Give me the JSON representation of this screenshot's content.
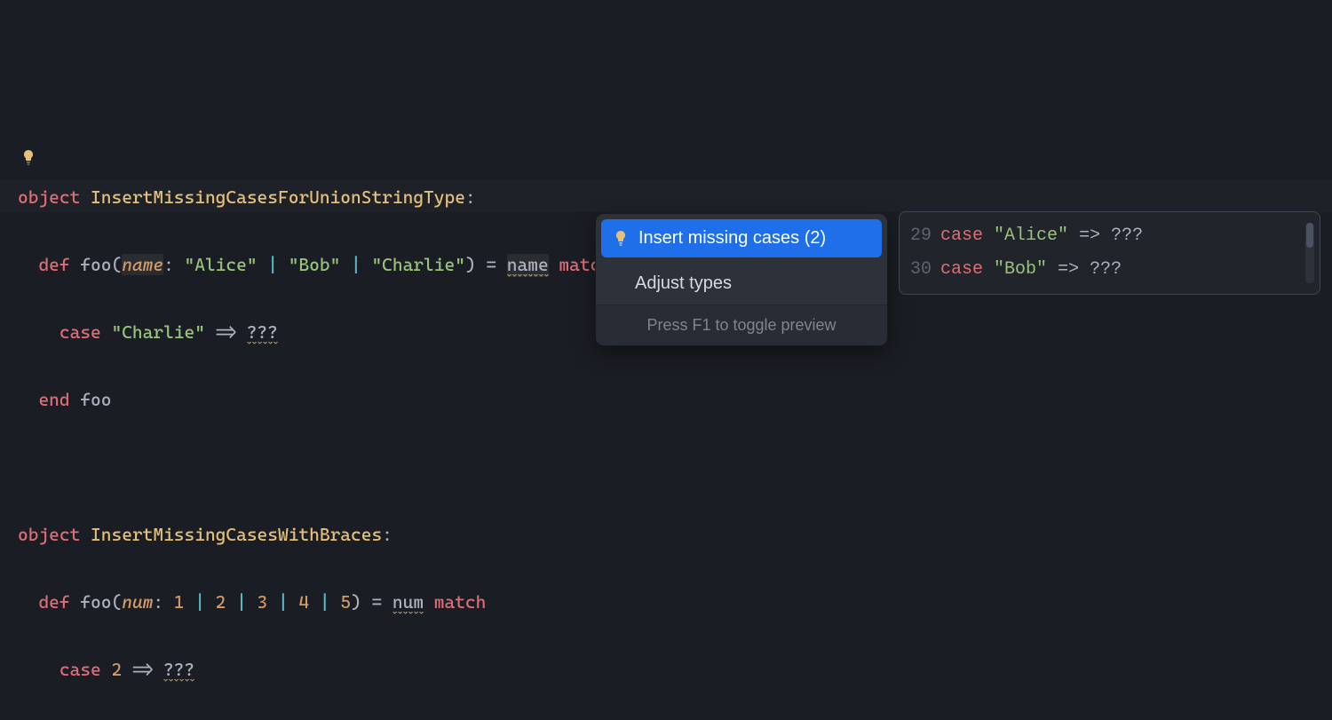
{
  "code": {
    "obj1_kw": "object",
    "obj1_name": "InsertMissingCasesForUnionStringType",
    "def_kw": "def",
    "foo_name": "foo",
    "param_name": "name",
    "alice": "\"Alice\"",
    "bob": "\"Bob\"",
    "charlie": "\"Charlie\"",
    "match_kw": "match",
    "case_kw": "case",
    "arrow": "=>",
    "qqq": "???",
    "end_kw": "end",
    "obj2_name": "InsertMissingCasesWithBraces",
    "param_num": "num",
    "n1": "1",
    "n2": "2",
    "n3": "3",
    "n4": "4",
    "n5": "5"
  },
  "popup": {
    "action1": "Insert missing cases (2)",
    "action2": "Adjust types",
    "footer": "Press F1 to toggle preview"
  },
  "preview": {
    "lines": [
      "29",
      "30"
    ],
    "l29": "29",
    "l30": "30"
  }
}
